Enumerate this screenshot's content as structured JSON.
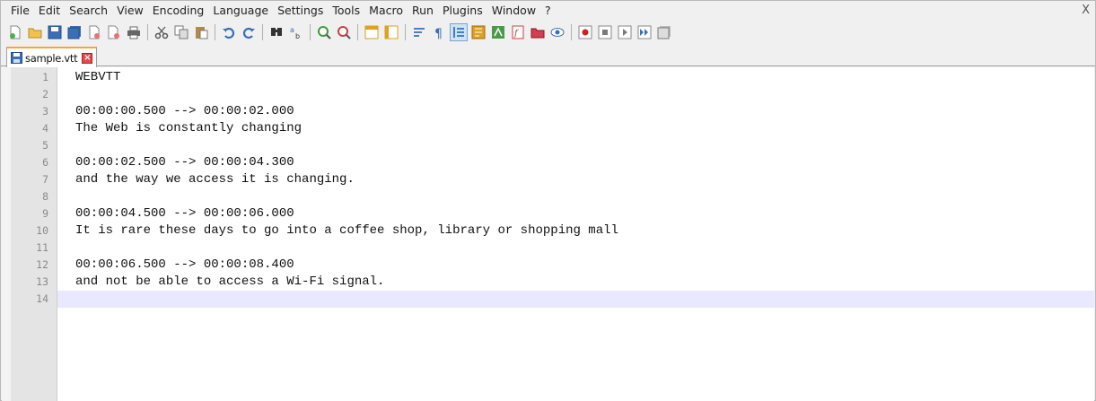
{
  "menu": [
    "File",
    "Edit",
    "Search",
    "View",
    "Encoding",
    "Language",
    "Settings",
    "Tools",
    "Macro",
    "Run",
    "Plugins",
    "Window",
    "?"
  ],
  "close_glyph": "X",
  "toolbar": [
    {
      "icon": "new-file-icon",
      "color": "#e8e8e8"
    },
    {
      "icon": "open-file-icon",
      "color": "#f2c24f"
    },
    {
      "icon": "save-icon",
      "color": "#3a6fb7"
    },
    {
      "icon": "save-all-icon",
      "color": "#3a6fb7"
    },
    {
      "icon": "close-icon",
      "color": "#9bb8d8"
    },
    {
      "icon": "close-all-icon",
      "color": "#9bb8d8"
    },
    {
      "icon": "print-icon",
      "color": "#666666"
    },
    {
      "sep": true
    },
    {
      "icon": "cut-icon",
      "color": "#555555"
    },
    {
      "icon": "copy-icon",
      "color": "#777777"
    },
    {
      "icon": "paste-icon",
      "color": "#b08a4a"
    },
    {
      "sep": true
    },
    {
      "icon": "undo-icon",
      "color": "#3a6fb7"
    },
    {
      "icon": "redo-icon",
      "color": "#3a6fb7"
    },
    {
      "sep": true
    },
    {
      "icon": "find-icon",
      "color": "#333333"
    },
    {
      "icon": "replace-icon",
      "color": "#3a6fb7"
    },
    {
      "sep": true
    },
    {
      "icon": "zoom-in-icon",
      "color": "#3c9b3c"
    },
    {
      "icon": "zoom-out-icon",
      "color": "#c84040"
    },
    {
      "sep": true
    },
    {
      "icon": "sync-vertical-icon",
      "color": "#e0a020"
    },
    {
      "icon": "sync-horizontal-icon",
      "color": "#e0a020"
    },
    {
      "sep": true
    },
    {
      "icon": "word-wrap-icon",
      "color": "#3a6fb7"
    },
    {
      "icon": "show-all-chars-icon",
      "color": "#3a6fb7"
    },
    {
      "icon": "indent-guide-icon",
      "color": "#3a6fb7",
      "active": true
    },
    {
      "icon": "document-map-icon",
      "color": "#e0a020"
    },
    {
      "icon": "function-list-icon",
      "color": "#4a9a4a"
    },
    {
      "icon": "folder-workspace-icon",
      "color": "#c84040"
    },
    {
      "icon": "folder-icon",
      "color": "#d04050"
    },
    {
      "icon": "monitoring-icon",
      "color": "#3a6fb7"
    },
    {
      "sep": true
    },
    {
      "icon": "record-macro-icon",
      "color": "#d02020"
    },
    {
      "icon": "stop-recording-icon",
      "color": "#7a7a7a"
    },
    {
      "icon": "playback-icon",
      "color": "#7a7a7a"
    },
    {
      "icon": "run-macro-multiple-icon",
      "color": "#3a6fb7"
    },
    {
      "icon": "save-macro-icon",
      "color": "#7a7a7a"
    }
  ],
  "tab": {
    "label": "sample.vtt",
    "close_glyph": "×"
  },
  "editor": {
    "current_line": 14,
    "lines": [
      {
        "num": "1",
        "text": "WEBVTT"
      },
      {
        "num": "2",
        "text": ""
      },
      {
        "num": "3",
        "text": "00:00:00.500 --> 00:00:02.000"
      },
      {
        "num": "4",
        "text": "The Web is constantly changing"
      },
      {
        "num": "5",
        "text": ""
      },
      {
        "num": "6",
        "text": "00:00:02.500 --> 00:00:04.300"
      },
      {
        "num": "7",
        "text": "and the way we access it is changing."
      },
      {
        "num": "8",
        "text": ""
      },
      {
        "num": "9",
        "text": "00:00:04.500 --> 00:00:06.000"
      },
      {
        "num": "10",
        "text": "It is rare these days to go into a coffee shop, library or shopping mall"
      },
      {
        "num": "11",
        "text": ""
      },
      {
        "num": "12",
        "text": "00:00:06.500 --> 00:00:08.400"
      },
      {
        "num": "13",
        "text": "and not be able to access a Wi-Fi signal."
      },
      {
        "num": "14",
        "text": ""
      }
    ]
  }
}
